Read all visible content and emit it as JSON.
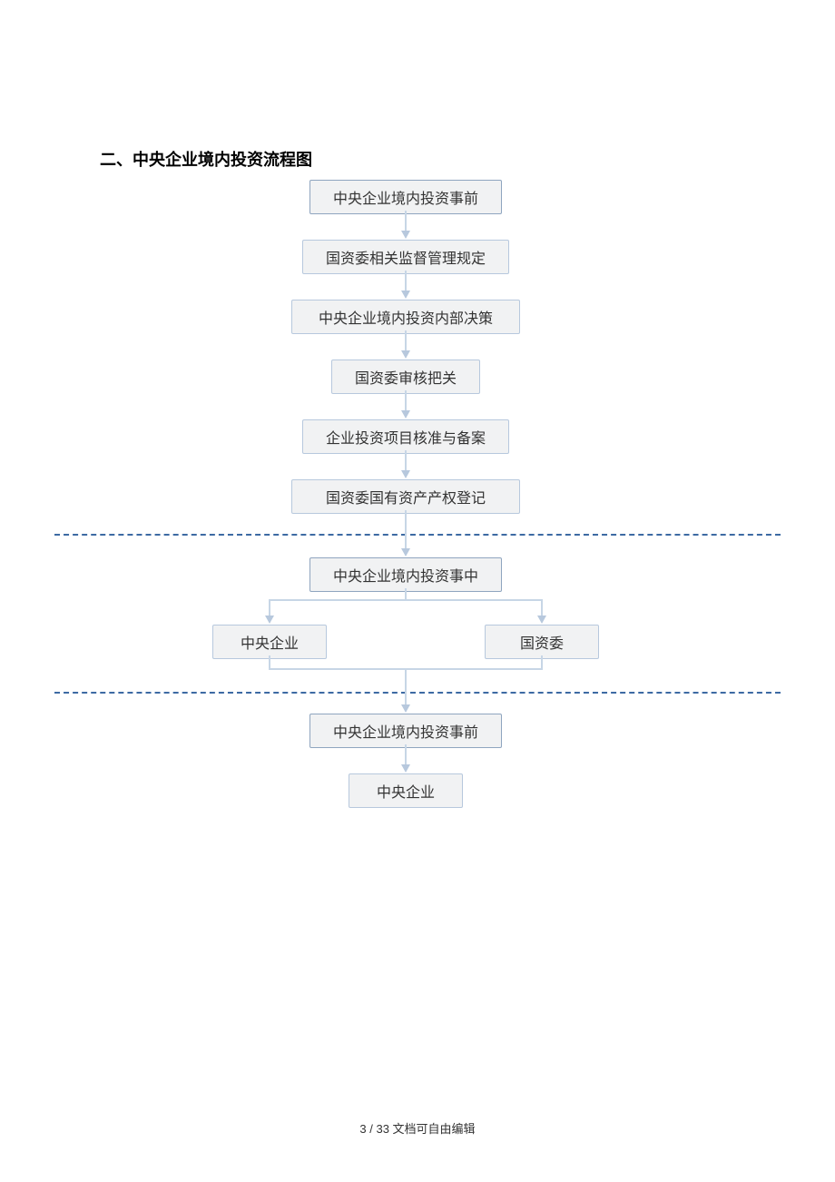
{
  "heading": "二、中央企业境内投资流程图",
  "boxes": {
    "b1": "中央企业境内投资事前",
    "b2": "国资委相关监督管理规定",
    "b3": "中央企业境内投资内部决策",
    "b4": "国资委审核把关",
    "b5": "企业投资项目核准与备案",
    "b6": "国资委国有资产产权登记",
    "b7": "中央企业境内投资事中",
    "b7a": "中央企业",
    "b7b": "国资委",
    "b8": "中央企业境内投资事前",
    "b9": "中央企业"
  },
  "footer": "3 / 33 文档可自由编辑"
}
